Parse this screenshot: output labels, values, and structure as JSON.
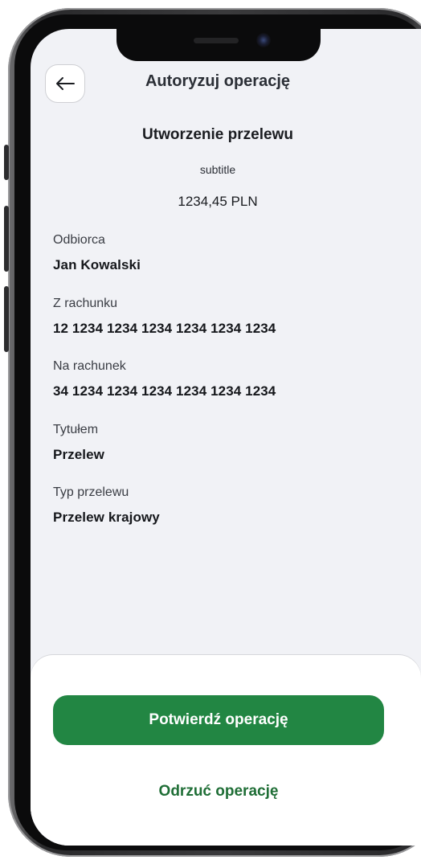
{
  "header": {
    "title": "Autoryzuj operację",
    "back_icon": "arrow-left-icon"
  },
  "operation": {
    "title": "Utworzenie przelewu",
    "subtitle": "subtitle",
    "amount": "1234,45 PLN"
  },
  "details": [
    {
      "label": "Odbiorca",
      "value": "Jan Kowalski"
    },
    {
      "label": "Z rachunku",
      "value": "12 1234 1234 1234 1234 1234 1234"
    },
    {
      "label": "Na rachunek",
      "value": "34 1234 1234 1234 1234 1234 1234"
    },
    {
      "label": "Tytułem",
      "value": "Przelew"
    },
    {
      "label": "Typ przelewu",
      "value": "Przelew krajowy"
    }
  ],
  "actions": {
    "confirm_label": "Potwierdź operację",
    "reject_label": "Odrzuć operację"
  },
  "colors": {
    "primary_green": "#228643",
    "reject_text_green": "#1f6e36",
    "screen_background": "#f1f2f6"
  }
}
